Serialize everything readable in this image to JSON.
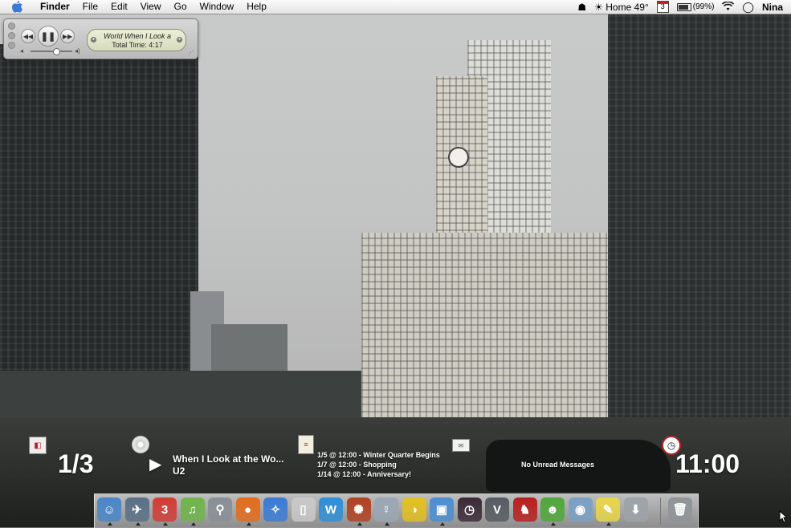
{
  "menubar": {
    "app_name": "Finder",
    "menus": [
      "File",
      "Edit",
      "View",
      "Go",
      "Window",
      "Help"
    ],
    "weather": "Home 49°",
    "calendar_day": "3",
    "battery": "(99%)",
    "user": "Nina"
  },
  "mini_player": {
    "line1": "World   When I Look a",
    "line2": "Total Time: 4:17",
    "prev_icon": "rewind-icon",
    "play_icon": "pause-icon",
    "next_icon": "fast-forward-icon"
  },
  "desktop": {
    "page_counter": "1/3",
    "now_playing_title": "When I Look at the Wo...",
    "now_playing_artist": "U2",
    "calendar_events": [
      "1/5 @ 12:00 - Winter Quarter Begins",
      "1/7 @ 12:00 - Shopping",
      "1/14 @ 12:00 - Anniversary!"
    ],
    "mail_status": "No Unread Messages",
    "clock": "11:00"
  },
  "dock": {
    "items": [
      {
        "name": "finder",
        "glyph": "☺",
        "color": "#4a86c8",
        "running": true
      },
      {
        "name": "mail-stamp",
        "glyph": "✈",
        "color": "#5a6f86",
        "running": true
      },
      {
        "name": "ical",
        "glyph": "3",
        "color": "#d23b35",
        "running": true
      },
      {
        "name": "itunes",
        "glyph": "♫",
        "color": "#6fb44a",
        "running": true
      },
      {
        "name": "satellite",
        "glyph": "⚲",
        "color": "#8a8f96",
        "running": false
      },
      {
        "name": "firefox",
        "glyph": "●",
        "color": "#e36c1d",
        "running": true
      },
      {
        "name": "safari",
        "glyph": "✧",
        "color": "#3a7bd5",
        "running": false
      },
      {
        "name": "ipod",
        "glyph": "▯",
        "color": "#c9c9c9",
        "running": false
      },
      {
        "name": "word",
        "glyph": "W",
        "color": "#2d8fd8",
        "running": false
      },
      {
        "name": "burn",
        "glyph": "✺",
        "color": "#b04121",
        "running": true
      },
      {
        "name": "ichat",
        "glyph": "☿",
        "color": "#9aa7b4",
        "running": true
      },
      {
        "name": "colorsync",
        "glyph": "◑",
        "color": "#e2c01f",
        "running": false
      },
      {
        "name": "preview",
        "glyph": "▣",
        "color": "#4b8ed3",
        "running": true
      },
      {
        "name": "clock-app",
        "glyph": "◷",
        "color": "#3a2836",
        "running": false
      },
      {
        "name": "vpn",
        "glyph": "V",
        "color": "#555b60",
        "running": false
      },
      {
        "name": "rooster",
        "glyph": "♞",
        "color": "#b81e1e",
        "running": false
      },
      {
        "name": "adium",
        "glyph": "☻",
        "color": "#4fa83a",
        "running": true
      },
      {
        "name": "iphoto",
        "glyph": "◉",
        "color": "#7aa0c6",
        "running": false
      },
      {
        "name": "stickies",
        "glyph": "✎",
        "color": "#e8d64b",
        "running": true
      },
      {
        "name": "downloads",
        "glyph": "⬇",
        "color": "#9ea3a8",
        "running": false
      },
      {
        "name": "trash",
        "glyph": "🗑",
        "color": "#8f9499",
        "running": false
      }
    ]
  }
}
